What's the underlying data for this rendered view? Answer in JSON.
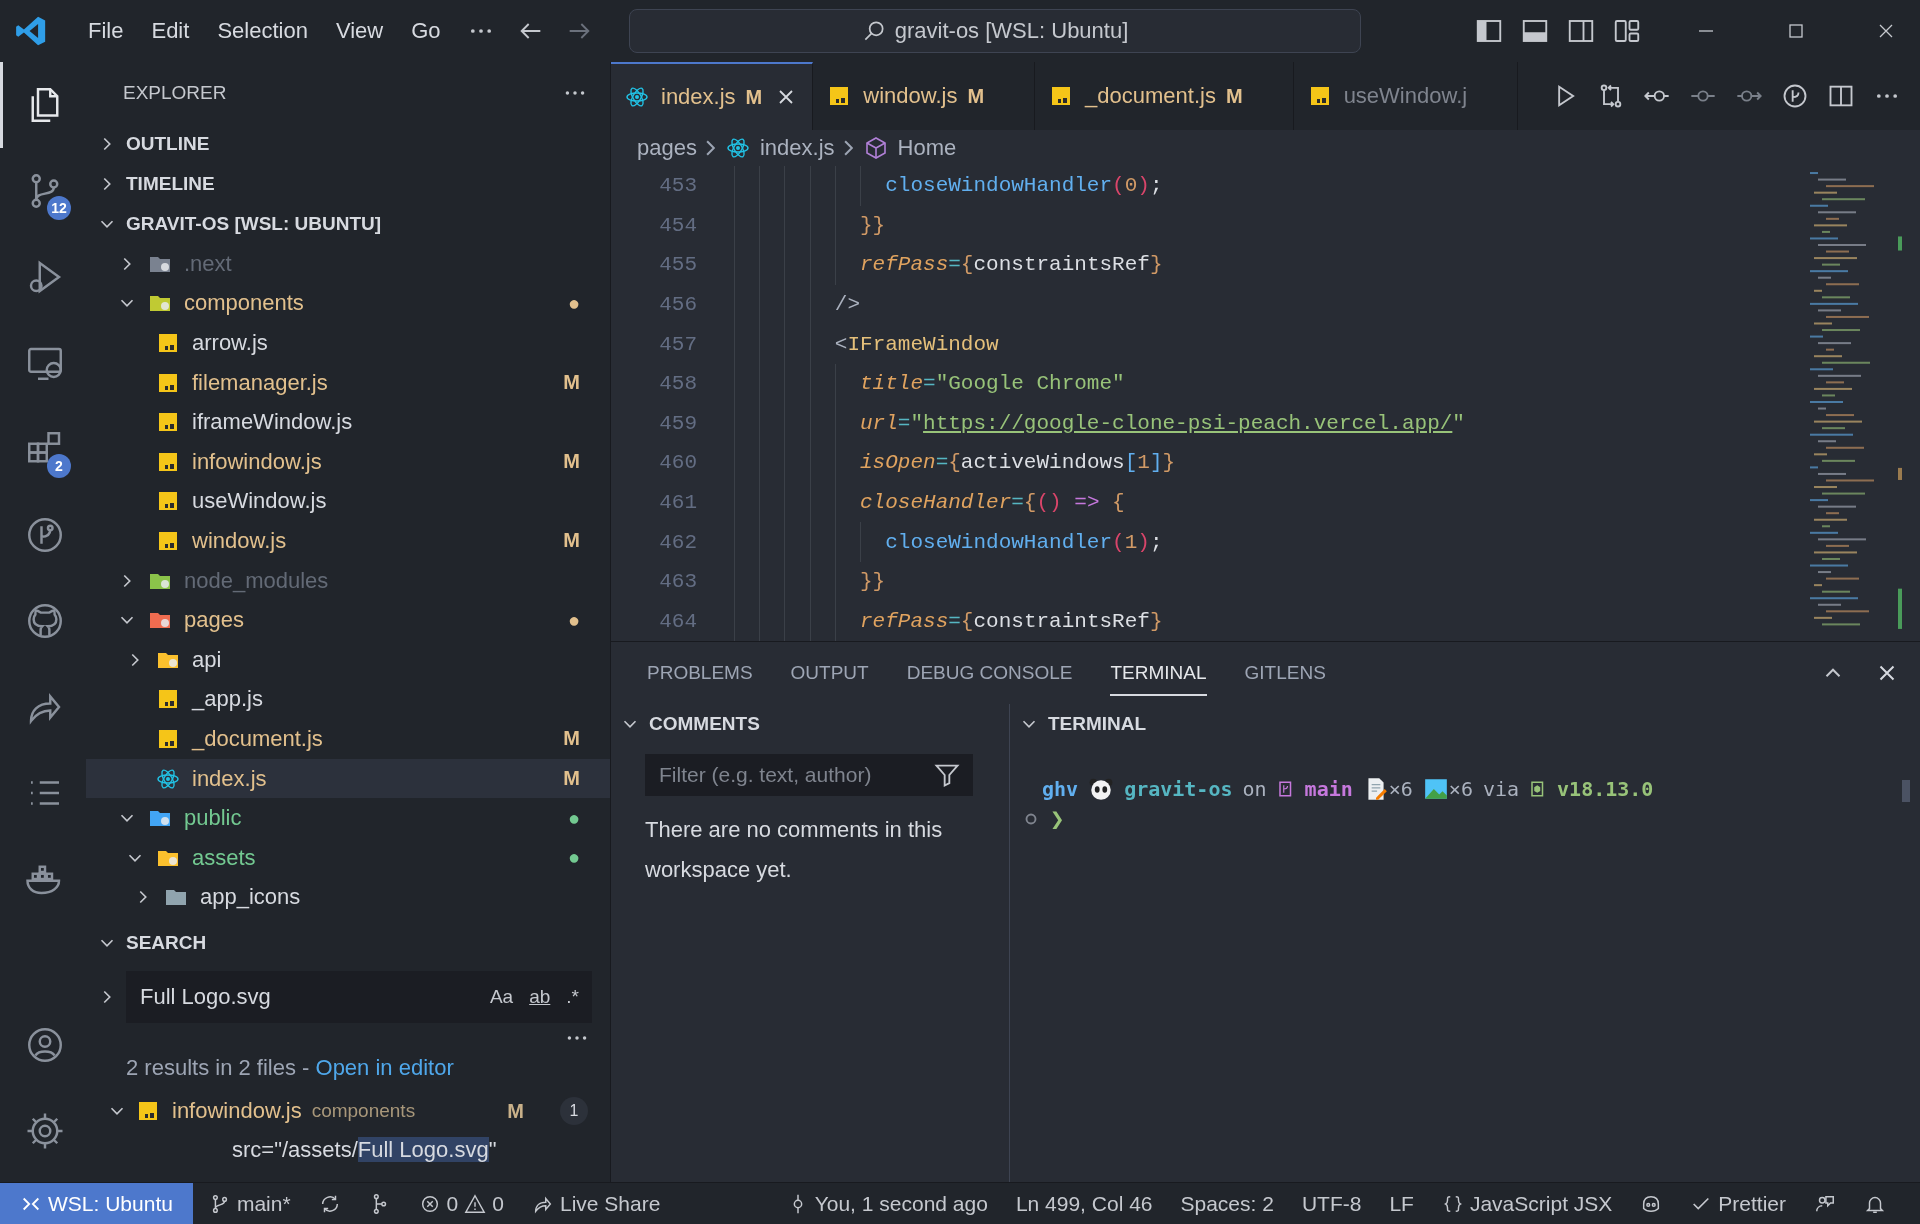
{
  "title_bar": {
    "menu": [
      "File",
      "Edit",
      "Selection",
      "View",
      "Go"
    ],
    "command_center": "gravit-os [WSL: Ubuntu]"
  },
  "activity_bar": {
    "items": [
      {
        "kind": "files",
        "selected": true
      },
      {
        "kind": "source-control",
        "badge": "12",
        "selected": false
      },
      {
        "kind": "run-debug",
        "selected": false
      },
      {
        "kind": "remote",
        "selected": false
      },
      {
        "kind": "extensions",
        "badge": "2",
        "selected": false
      },
      {
        "kind": "gitlens",
        "selected": false
      },
      {
        "kind": "github",
        "selected": false
      },
      {
        "kind": "live-share",
        "selected": false
      },
      {
        "kind": "list",
        "selected": false
      },
      {
        "kind": "docker",
        "selected": false
      }
    ],
    "bottom": [
      {
        "kind": "account"
      },
      {
        "kind": "settings"
      }
    ]
  },
  "sidebar": {
    "title": "EXPLORER",
    "sections": [
      {
        "label": "OUTLINE",
        "expanded": false
      },
      {
        "label": "TIMELINE",
        "expanded": false
      },
      {
        "label": "GRAVIT-OS [WSL: UBUNTU]",
        "expanded": true,
        "tree": [
          {
            "name": ".next",
            "kind": "folder-next",
            "color": "#636a76",
            "expanded": false,
            "selected": false
          },
          {
            "name": "components",
            "kind": "folder-components",
            "color": "#e2c08d",
            "badge": "●",
            "expanded": true,
            "selected": false,
            "children": [
              {
                "name": "arrow.js",
                "kind": "js",
                "color": "#d7dae0",
                "selected": false
              },
              {
                "name": "filemanager.js",
                "kind": "js",
                "color": "#e2c08d",
                "badge": "M",
                "selected": false
              },
              {
                "name": "iframeWindow.js",
                "kind": "js",
                "color": "#d7dae0",
                "selected": false
              },
              {
                "name": "infowindow.js",
                "kind": "js",
                "color": "#e2c08d",
                "badge": "M",
                "selected": false
              },
              {
                "name": "useWindow.js",
                "kind": "js",
                "color": "#d7dae0",
                "selected": false
              },
              {
                "name": "window.js",
                "kind": "js",
                "color": "#e2c08d",
                "badge": "M",
                "selected": false
              }
            ]
          },
          {
            "name": "node_modules",
            "kind": "folder-node",
            "color": "#636a76",
            "expanded": false,
            "selected": false
          },
          {
            "name": "pages",
            "kind": "folder-pages",
            "color": "#e2c08d",
            "badge": "●",
            "expanded": true,
            "selected": false,
            "children": [
              {
                "name": "api",
                "kind": "folder-api",
                "color": "#d7dae0",
                "expanded": false,
                "selected": false
              },
              {
                "name": "_app.js",
                "kind": "js",
                "color": "#d7dae0",
                "selected": false
              },
              {
                "name": "_document.js",
                "kind": "js",
                "color": "#e2c08d",
                "badge": "M",
                "selected": false
              },
              {
                "name": "index.js",
                "kind": "react",
                "color": "#e2c08d",
                "badge": "M",
                "selected": true
              }
            ]
          },
          {
            "name": "public",
            "kind": "folder-public",
            "color": "#73c991",
            "badge": "●",
            "expanded": true,
            "selected": false,
            "children": [
              {
                "name": "assets",
                "kind": "folder-assets",
                "color": "#73c991",
                "badge": "●",
                "expanded": true,
                "selected": false,
                "children": [
                  {
                    "name": "app_icons",
                    "kind": "folder",
                    "color": "#d7dae0",
                    "expanded": false,
                    "selected": false
                  }
                ]
              }
            ]
          }
        ]
      }
    ],
    "search": {
      "label": "SEARCH",
      "expanded": true,
      "query": "Full Logo.svg",
      "options": [
        "Aa",
        "ab",
        ".*"
      ],
      "summary": "2 results in 2 files - ",
      "summary_link": "Open in editor",
      "results": [
        {
          "file": "infowindow.js",
          "folder": "components",
          "badge": "M",
          "count": "1",
          "expanded": true,
          "match_before": "src=\"/assets/",
          "match": "Full Logo.svg",
          "match_after": "\""
        }
      ]
    }
  },
  "editor": {
    "tabs": [
      {
        "label": "index.js",
        "kind": "react",
        "badge": "M",
        "selected": true
      },
      {
        "label": "window.js",
        "kind": "js",
        "badge": "M",
        "selected": false
      },
      {
        "label": "_document.js",
        "kind": "js",
        "badge": "M",
        "selected": false
      },
      {
        "label": "useWindow.j",
        "kind": "js",
        "selected": false
      }
    ],
    "breadcrumbs": [
      {
        "text": "pages",
        "kind": "folder"
      },
      {
        "text": "index.js",
        "kind": "react"
      },
      {
        "text": "Home",
        "kind": "component"
      }
    ],
    "lines": [
      {
        "number": "453",
        "tokens": [
          {
            "text": "            closeWindowHandler",
            "kind": "fn"
          },
          {
            "text": "(",
            "kind": "paren"
          },
          {
            "text": "0",
            "kind": "num"
          },
          {
            "text": ")",
            "kind": "paren"
          },
          {
            "text": ";",
            "kind": "plain"
          }
        ]
      },
      {
        "number": "454",
        "tokens": [
          {
            "text": "          }}",
            "kind": "brace"
          }
        ]
      },
      {
        "number": "455",
        "tokens": [
          {
            "text": "          refPass",
            "kind": "attr"
          },
          {
            "text": "=",
            "kind": "eq"
          },
          {
            "text": "{",
            "kind": "brace"
          },
          {
            "text": "constraintsRef",
            "kind": "plain"
          },
          {
            "text": "}",
            "kind": "brace"
          }
        ]
      },
      {
        "number": "456",
        "tokens": [
          {
            "text": "        />",
            "kind": "punct"
          }
        ]
      },
      {
        "number": "457",
        "tokens": [
          {
            "text": "        <",
            "kind": "punct"
          },
          {
            "text": "IFrameWindow",
            "kind": "tag"
          }
        ]
      },
      {
        "number": "458",
        "tokens": [
          {
            "text": "          title",
            "kind": "attr"
          },
          {
            "text": "=",
            "kind": "eq"
          },
          {
            "text": "\"Google Chrome\"",
            "kind": "str"
          }
        ]
      },
      {
        "number": "459",
        "tokens": [
          {
            "text": "          url",
            "kind": "attr"
          },
          {
            "text": "=",
            "kind": "eq"
          },
          {
            "text": "\"",
            "kind": "str"
          },
          {
            "text": "https://google-clone-psi-peach.vercel.app/",
            "kind": "link"
          },
          {
            "text": "\"",
            "kind": "str"
          }
        ]
      },
      {
        "number": "460",
        "tokens": [
          {
            "text": "          isOpen",
            "kind": "attr"
          },
          {
            "text": "=",
            "kind": "eq"
          },
          {
            "text": "{",
            "kind": "brace"
          },
          {
            "text": "activeWindows",
            "kind": "plain"
          },
          {
            "text": "[",
            "kind": "bracket"
          },
          {
            "text": "1",
            "kind": "num"
          },
          {
            "text": "]",
            "kind": "bracket"
          },
          {
            "text": "}",
            "kind": "brace"
          }
        ]
      },
      {
        "number": "461",
        "tokens": [
          {
            "text": "          closeHandler",
            "kind": "attr"
          },
          {
            "text": "=",
            "kind": "eq"
          },
          {
            "text": "{",
            "kind": "brace"
          },
          {
            "text": "()",
            "kind": "paren"
          },
          {
            "text": " => ",
            "kind": "arrow"
          },
          {
            "text": "{",
            "kind": "brace"
          }
        ]
      },
      {
        "number": "462",
        "tokens": [
          {
            "text": "            closeWindowHandler",
            "kind": "fn"
          },
          {
            "text": "(",
            "kind": "paren"
          },
          {
            "text": "1",
            "kind": "num"
          },
          {
            "text": ")",
            "kind": "paren"
          },
          {
            "text": ";",
            "kind": "plain"
          }
        ]
      },
      {
        "number": "463",
        "tokens": [
          {
            "text": "          }}",
            "kind": "brace"
          }
        ]
      },
      {
        "number": "464",
        "tokens": [
          {
            "text": "          refPass",
            "kind": "attr"
          },
          {
            "text": "=",
            "kind": "eq"
          },
          {
            "text": "{",
            "kind": "brace"
          },
          {
            "text": "constraintsRef",
            "kind": "plain"
          },
          {
            "text": "}",
            "kind": "brace"
          }
        ]
      }
    ]
  },
  "panel": {
    "tabs": [
      {
        "label": "PROBLEMS",
        "selected": false
      },
      {
        "label": "OUTPUT",
        "selected": false
      },
      {
        "label": "DEBUG CONSOLE",
        "selected": false
      },
      {
        "label": "TERMINAL",
        "selected": true
      },
      {
        "label": "GITLENS",
        "selected": false
      }
    ],
    "comments": {
      "label": "COMMENTS",
      "expanded": true,
      "filter_placeholder": "Filter (e.g. text, author)",
      "message": "There are no comments in this workspace yet."
    },
    "terminal": {
      "label": "TERMINAL",
      "expanded": true,
      "prompt": [
        {
          "kind": "user",
          "text": "ghv"
        },
        {
          "kind": "panda"
        },
        {
          "kind": "dir",
          "text": "gravit-os"
        },
        {
          "kind": "plain",
          "text": "on"
        },
        {
          "kind": "branch-glyph"
        },
        {
          "kind": "branch",
          "text": "main"
        },
        {
          "kind": "memo"
        },
        {
          "kind": "tight",
          "text": "×6"
        },
        {
          "kind": "picture"
        },
        {
          "kind": "tight",
          "text": "×6"
        },
        {
          "kind": "plain",
          "text": "via"
        },
        {
          "kind": "node-glyph"
        },
        {
          "kind": "version",
          "text": "v18.13.0"
        }
      ],
      "cursor_prompt": "❯"
    }
  },
  "status_bar": {
    "left": [
      {
        "kind": "remote",
        "text": "WSL: Ubuntu"
      },
      {
        "kind": "branch",
        "text": "main*"
      },
      {
        "kind": "sync"
      },
      {
        "kind": "graph"
      },
      {
        "kind": "problems",
        "errors": "0",
        "warnings": "0"
      },
      {
        "kind": "live-share",
        "text": "Live Share"
      }
    ],
    "right": [
      {
        "kind": "blame",
        "text": "You, 1 second ago"
      },
      {
        "kind": "text",
        "text": "Ln 499, Col 46"
      },
      {
        "kind": "text",
        "text": "Spaces: 2"
      },
      {
        "kind": "text",
        "text": "UTF-8"
      },
      {
        "kind": "text",
        "text": "LF"
      },
      {
        "kind": "language",
        "text": "JavaScript JSX"
      },
      {
        "kind": "copilot"
      },
      {
        "kind": "prettier",
        "text": "Prettier"
      },
      {
        "kind": "feedback"
      },
      {
        "kind": "bell"
      }
    ]
  }
}
